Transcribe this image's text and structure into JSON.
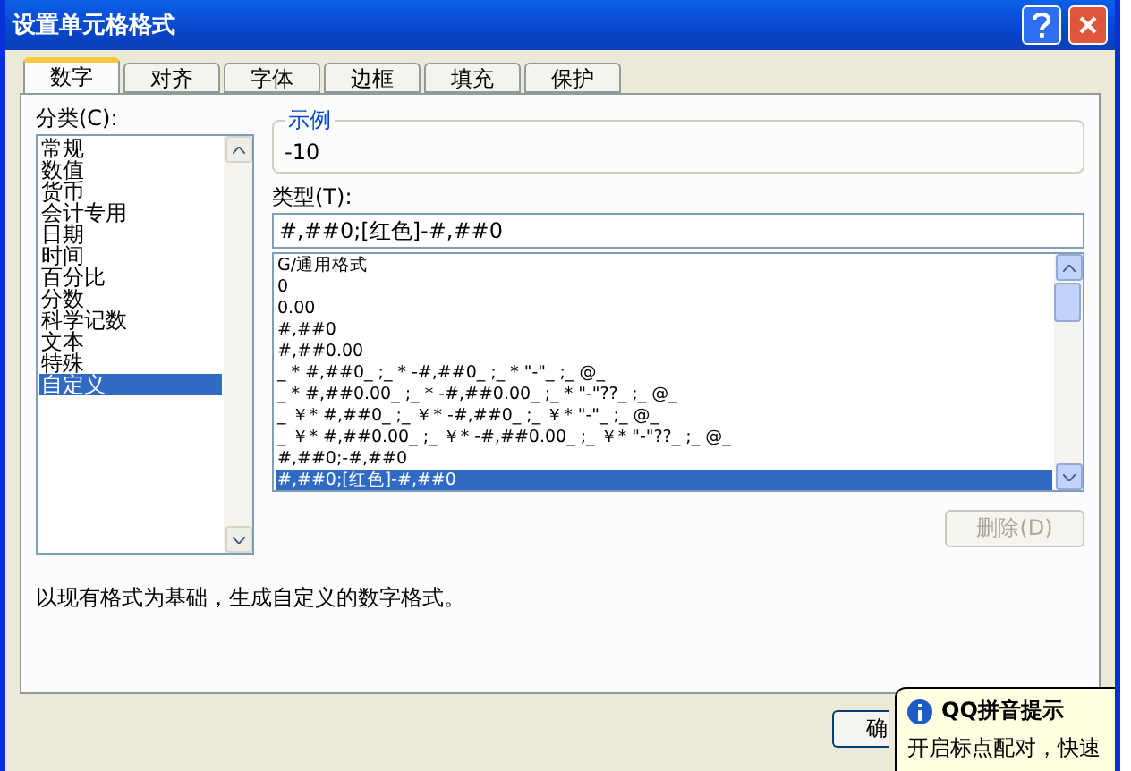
{
  "window": {
    "title": "设置单元格格式"
  },
  "tabs": [
    {
      "label": "数字",
      "selected": true
    },
    {
      "label": "对齐",
      "selected": false
    },
    {
      "label": "字体",
      "selected": false
    },
    {
      "label": "边框",
      "selected": false
    },
    {
      "label": "填充",
      "selected": false
    },
    {
      "label": "保护",
      "selected": false
    }
  ],
  "category": {
    "label": "分类(C):",
    "items": [
      {
        "label": "常规",
        "selected": false
      },
      {
        "label": "数值",
        "selected": false
      },
      {
        "label": "货币",
        "selected": false
      },
      {
        "label": "会计专用",
        "selected": false
      },
      {
        "label": "日期",
        "selected": false
      },
      {
        "label": "时间",
        "selected": false
      },
      {
        "label": "百分比",
        "selected": false
      },
      {
        "label": "分数",
        "selected": false
      },
      {
        "label": "科学记数",
        "selected": false
      },
      {
        "label": "文本",
        "selected": false
      },
      {
        "label": "特殊",
        "selected": false
      },
      {
        "label": "自定义",
        "selected": true
      }
    ]
  },
  "sample": {
    "label": "示例",
    "value": "-10"
  },
  "type": {
    "label": "类型(T):",
    "value": "#,##0;[红色]-#,##0",
    "items": [
      {
        "label": "G/通用格式",
        "selected": false
      },
      {
        "label": "0",
        "selected": false
      },
      {
        "label": "0.00",
        "selected": false
      },
      {
        "label": "#,##0",
        "selected": false
      },
      {
        "label": "#,##0.00",
        "selected": false
      },
      {
        "label": "_ * #,##0_ ;_ * -#,##0_ ;_ * \"-\"_ ;_ @_",
        "selected": false
      },
      {
        "label": "_ * #,##0.00_ ;_ * -#,##0.00_ ;_ * \"-\"??_ ;_ @_",
        "selected": false
      },
      {
        "label": "_ ￥* #,##0_ ;_ ￥* -#,##0_ ;_ ￥* \"-\"_ ;_ @_",
        "selected": false
      },
      {
        "label": "_ ￥* #,##0.00_ ;_ ￥* -#,##0.00_ ;_ ￥* \"-\"??_ ;_ @_",
        "selected": false
      },
      {
        "label": "#,##0;-#,##0",
        "selected": false
      },
      {
        "label": "#,##0;[红色]-#,##0",
        "selected": true
      }
    ]
  },
  "delete_button": {
    "label": "删除(D)",
    "disabled": true
  },
  "description": "以现有格式为基础，生成自定义的数字格式。",
  "ok_button": {
    "label": "确"
  },
  "tooltip": {
    "title": "QQ拼音提示",
    "text": "开启标点配对，快速"
  }
}
